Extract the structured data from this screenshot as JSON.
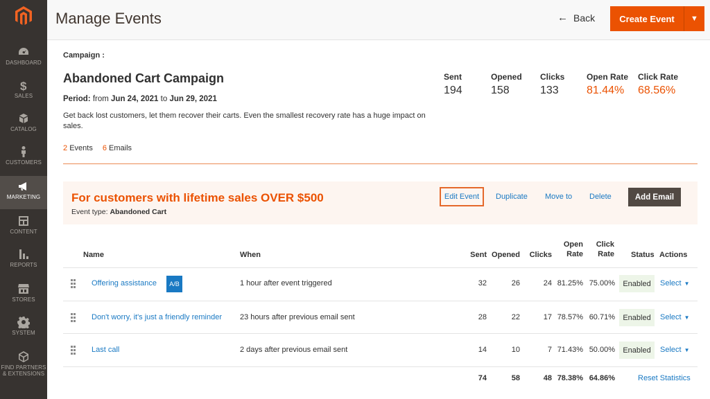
{
  "sidebar": {
    "items": [
      {
        "label": "DASHBOARD",
        "icon": "dashboard-icon"
      },
      {
        "label": "SALES",
        "icon": "dollar-icon"
      },
      {
        "label": "CATALOG",
        "icon": "box-icon"
      },
      {
        "label": "CUSTOMERS",
        "icon": "person-icon"
      },
      {
        "label": "MARKETING",
        "icon": "megaphone-icon",
        "active": true
      },
      {
        "label": "CONTENT",
        "icon": "layout-icon"
      },
      {
        "label": "REPORTS",
        "icon": "bar-chart-icon"
      },
      {
        "label": "STORES",
        "icon": "store-icon"
      },
      {
        "label": "SYSTEM",
        "icon": "gear-icon"
      },
      {
        "label": "FIND PARTNERS & EXTENSIONS",
        "icon": "cube-icon"
      }
    ]
  },
  "header": {
    "title": "Manage Events",
    "back_label": "Back",
    "create_label": "Create Event"
  },
  "campaign": {
    "label": "Campaign :",
    "name": "Abandoned Cart Campaign",
    "period_label": "Period:",
    "period_from_word": "from",
    "period_from": "Jun 24, 2021",
    "period_to_word": "to",
    "period_to": "Jun 29, 2021",
    "description": "Get back lost customers, let them recover their carts. Even the smallest recovery rate has a huge impact on sales.",
    "events_count": "2",
    "events_label": "Events",
    "emails_count": "6",
    "emails_label": "Emails",
    "stats": {
      "sent_label": "Sent",
      "sent": "194",
      "opened_label": "Opened",
      "opened": "158",
      "clicks_label": "Clicks",
      "clicks": "133",
      "open_rate_label": "Open Rate",
      "open_rate": "81.44%",
      "click_rate_label": "Click Rate",
      "click_rate": "68.56%"
    }
  },
  "event": {
    "title": "For customers with lifetime sales OVER $500",
    "type_label": "Event type:",
    "type_value": "Abandoned Cart",
    "actions": {
      "edit": "Edit Event",
      "duplicate": "Duplicate",
      "move": "Move to",
      "delete": "Delete",
      "add_email": "Add Email"
    }
  },
  "table": {
    "headers": {
      "name": "Name",
      "when": "When",
      "sent": "Sent",
      "opened": "Opened",
      "clicks": "Clicks",
      "open_rate_1": "Open",
      "open_rate_2": "Rate",
      "click_rate_1": "Click",
      "click_rate_2": "Rate",
      "status": "Status",
      "actions": "Actions"
    },
    "rows": [
      {
        "name": "Offering assistance",
        "badge": "A/B",
        "when": "1 hour after event triggered",
        "sent": "32",
        "opened": "26",
        "clicks": "24",
        "open_rate": "81.25%",
        "click_rate": "75.00%",
        "status": "Enabled",
        "action": "Select"
      },
      {
        "name": "Don't worry, it's just a friendly reminder",
        "when": "23 hours after previous email sent",
        "sent": "28",
        "opened": "22",
        "clicks": "17",
        "open_rate": "78.57%",
        "click_rate": "60.71%",
        "status": "Enabled",
        "action": "Select"
      },
      {
        "name": "Last call",
        "when": "2 days after previous email sent",
        "sent": "14",
        "opened": "10",
        "clicks": "7",
        "open_rate": "71.43%",
        "click_rate": "50.00%",
        "status": "Enabled",
        "action": "Select"
      }
    ],
    "totals": {
      "sent": "74",
      "opened": "58",
      "clicks": "48",
      "open_rate": "78.38%",
      "click_rate": "64.86%",
      "reset_label": "Reset Statistics"
    }
  }
}
